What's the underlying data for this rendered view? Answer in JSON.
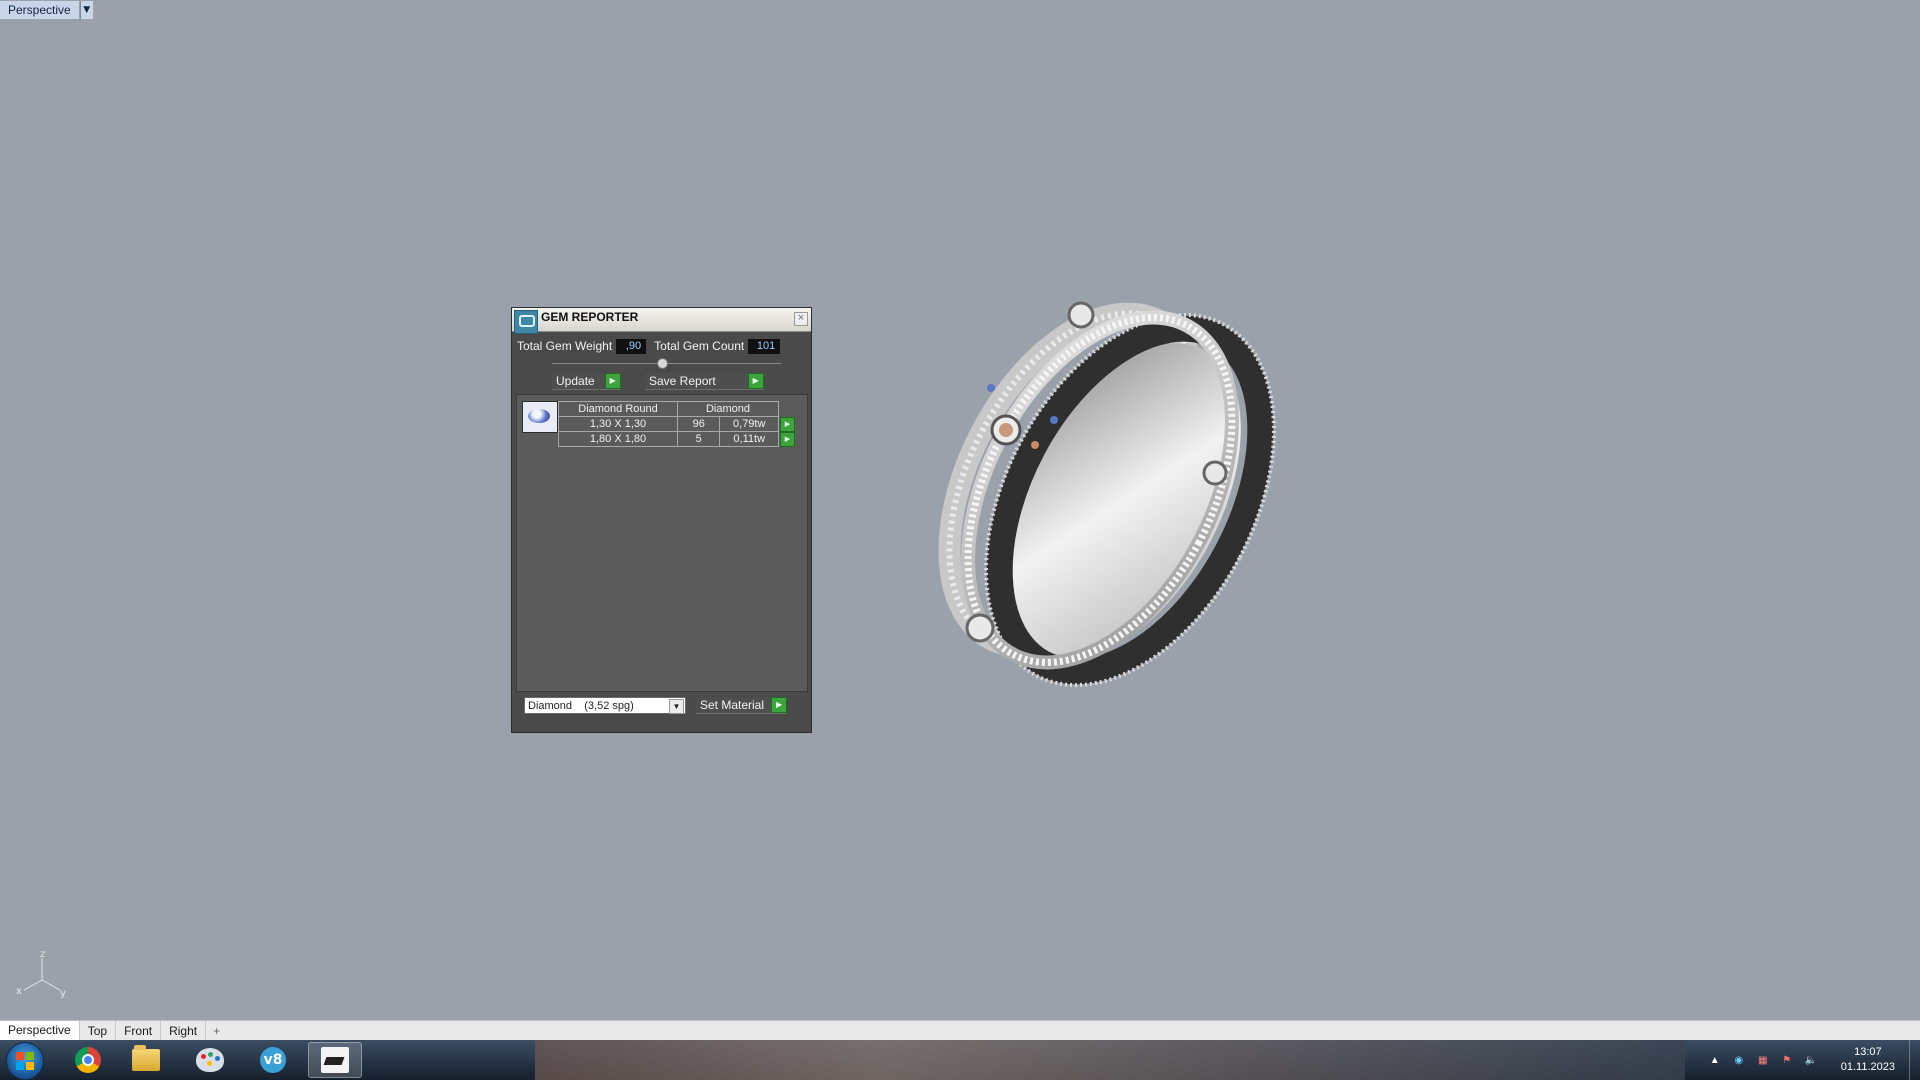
{
  "viewport": {
    "label": "Perspective",
    "tabs": [
      "Perspective",
      "Top",
      "Front",
      "Right"
    ],
    "add_tab": "+",
    "axes": {
      "z": "z",
      "x": "x",
      "y": "y"
    }
  },
  "gem_reporter": {
    "title": "GEM REPORTER",
    "close_icon": "close-icon",
    "total_weight_label": "Total Gem Weight",
    "total_weight_value": ",90",
    "total_count_label": "Total Gem Count",
    "total_count_value": "101",
    "update_label": "Update",
    "save_report_label": "Save Report",
    "table": {
      "headers": [
        "Diamond Round",
        "Diamond"
      ],
      "rows": [
        {
          "size": "1,30 X 1,30",
          "count": "96",
          "weight": "0,79tw"
        },
        {
          "size": "1,80 X 1,80",
          "count": "5",
          "weight": "0,11tw"
        }
      ]
    },
    "material_select": "Diamond    (3,52 spg)",
    "set_material_label": "Set Material"
  },
  "taskbar": {
    "apps": [
      "windows-start",
      "chrome",
      "file-explorer",
      "paint",
      "v8-app",
      "rhino"
    ],
    "clock_time": "13:07",
    "clock_date": "01.11.2023"
  }
}
